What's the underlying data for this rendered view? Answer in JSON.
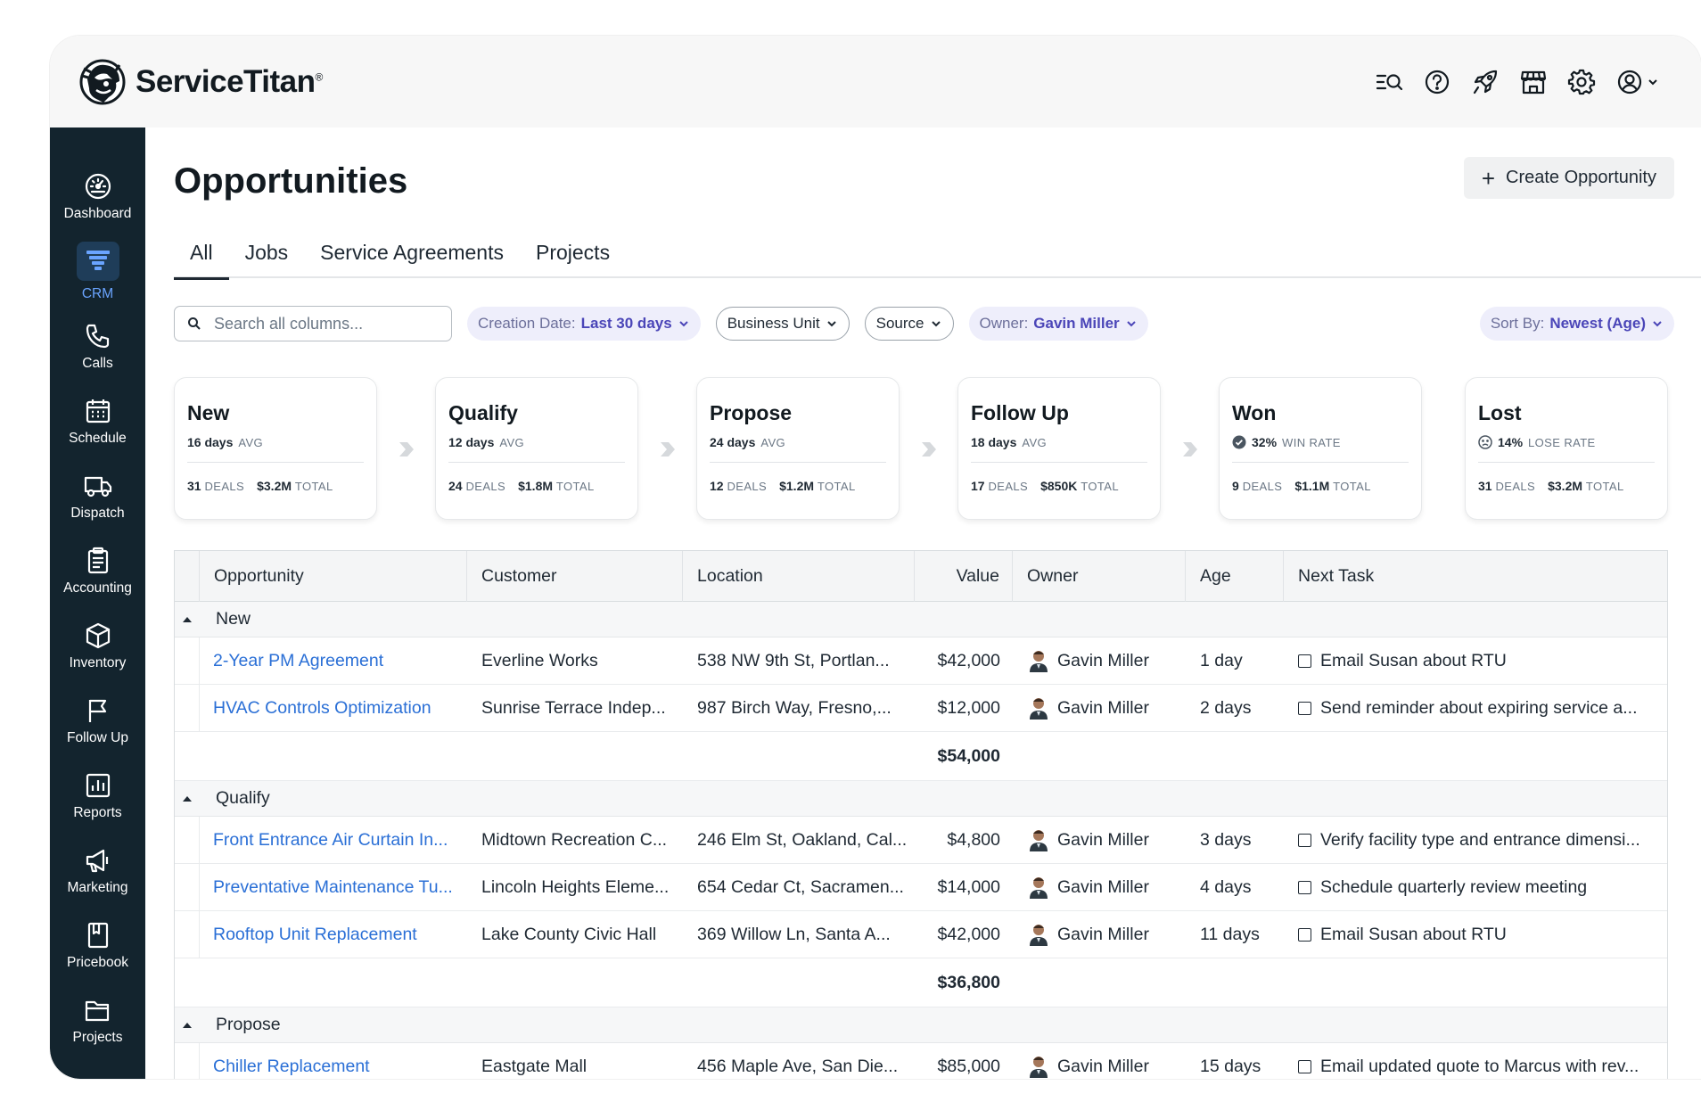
{
  "app": {
    "brand": "ServiceTitan",
    "brand_mark": "®"
  },
  "header_icons": [
    "search-list-icon",
    "help-icon",
    "rocket-icon",
    "store-icon",
    "gear-icon",
    "user-icon"
  ],
  "sidebar": {
    "items": [
      {
        "label": "Dashboard",
        "icon": "dashboard-icon"
      },
      {
        "label": "CRM",
        "icon": "funnel-icon",
        "active": true
      },
      {
        "label": "Calls",
        "icon": "phone-icon"
      },
      {
        "label": "Schedule",
        "icon": "calendar-icon"
      },
      {
        "label": "Dispatch",
        "icon": "truck-icon"
      },
      {
        "label": "Accounting",
        "icon": "clipboard-icon"
      },
      {
        "label": "Inventory",
        "icon": "box-icon"
      },
      {
        "label": "Follow Up",
        "icon": "flag-icon"
      },
      {
        "label": "Reports",
        "icon": "chart-icon"
      },
      {
        "label": "Marketing",
        "icon": "megaphone-icon"
      },
      {
        "label": "Pricebook",
        "icon": "book-icon"
      },
      {
        "label": "Projects",
        "icon": "folder-icon"
      }
    ]
  },
  "page": {
    "title": "Opportunities",
    "create_label": "Create Opportunity"
  },
  "tabs": [
    {
      "label": "All",
      "active": true
    },
    {
      "label": "Jobs"
    },
    {
      "label": "Service Agreements"
    },
    {
      "label": "Projects"
    }
  ],
  "filters": {
    "search_placeholder": "Search all columns...",
    "creation_label": "Creation Date:",
    "creation_value": "Last 30 days",
    "business_unit": "Business Unit",
    "source": "Source",
    "owner_label": "Owner:",
    "owner_value": "Gavin Miller",
    "sort_label": "Sort By:",
    "sort_value": "Newest (Age)"
  },
  "stages": [
    {
      "name": "New",
      "metric": "16 days",
      "metric_unit": "AVG",
      "deals": "31",
      "deals_unit": "DEALS",
      "total": "$3.2M",
      "total_unit": "TOTAL"
    },
    {
      "name": "Qualify",
      "metric": "12 days",
      "metric_unit": "AVG",
      "deals": "24",
      "deals_unit": "DEALS",
      "total": "$1.8M",
      "total_unit": "TOTAL"
    },
    {
      "name": "Propose",
      "metric": "24 days",
      "metric_unit": "AVG",
      "deals": "12",
      "deals_unit": "DEALS",
      "total": "$1.2M",
      "total_unit": "TOTAL"
    },
    {
      "name": "Follow Up",
      "metric": "18 days",
      "metric_unit": "AVG",
      "deals": "17",
      "deals_unit": "DEALS",
      "total": "$850K",
      "total_unit": "TOTAL"
    },
    {
      "name": "Won",
      "metric": "32%",
      "metric_unit": "WIN RATE",
      "deals": "9",
      "deals_unit": "DEALS",
      "total": "$1.1M",
      "total_unit": "TOTAL"
    },
    {
      "name": "Lost",
      "metric": "14%",
      "metric_unit": "LOSE RATE",
      "deals": "31",
      "deals_unit": "DEALS",
      "total": "$3.2M",
      "total_unit": "TOTAL"
    }
  ],
  "table": {
    "columns": [
      "Opportunity",
      "Customer",
      "Location",
      "Value",
      "Owner",
      "Age",
      "Next Task"
    ],
    "groups": [
      {
        "name": "New",
        "subtotal": "$54,000",
        "rows": [
          {
            "opportunity": "2-Year PM Agreement",
            "customer": "Everline Works",
            "location": "538 NW 9th St, Portlan...",
            "value": "$42,000",
            "owner": "Gavin Miller",
            "age": "1 day",
            "task": "Email Susan about RTU"
          },
          {
            "opportunity": "HVAC Controls Optimization",
            "customer": "Sunrise Terrace Indep...",
            "location": "987 Birch Way, Fresno,...",
            "value": "$12,000",
            "owner": "Gavin Miller",
            "age": "2 days",
            "task": "Send reminder about expiring service a..."
          }
        ]
      },
      {
        "name": "Qualify",
        "subtotal": "$36,800",
        "rows": [
          {
            "opportunity": "Front Entrance Air Curtain In...",
            "customer": "Midtown Recreation C...",
            "location": "246 Elm St, Oakland, Cal...",
            "value": "$4,800",
            "owner": "Gavin Miller",
            "age": "3 days",
            "task": "Verify facility type and entrance dimensi..."
          },
          {
            "opportunity": "Preventative Maintenance Tu...",
            "customer": "Lincoln Heights Eleme...",
            "location": "654 Cedar Ct, Sacramen...",
            "value": "$14,000",
            "owner": "Gavin Miller",
            "age": "4 days",
            "task": "Schedule quarterly review meeting"
          },
          {
            "opportunity": "Rooftop Unit Replacement",
            "customer": "Lake County Civic Hall",
            "location": "369 Willow Ln, Santa A...",
            "value": "$42,000",
            "owner": "Gavin Miller",
            "age": "11 days",
            "task": "Email Susan about RTU"
          }
        ]
      },
      {
        "name": "Propose",
        "rows": [
          {
            "opportunity": "Chiller Replacement",
            "customer": "Eastgate Mall",
            "location": "456 Maple Ave, San Die...",
            "value": "$85,000",
            "owner": "Gavin Miller",
            "age": "15 days",
            "task": "Email updated quote to Marcus with rev..."
          }
        ]
      }
    ]
  },
  "colors": {
    "sidebar_bg": "#13242e",
    "link": "#2a6fd6",
    "active_nav": "#6aa4ff",
    "chip_value": "#4b46b8"
  }
}
